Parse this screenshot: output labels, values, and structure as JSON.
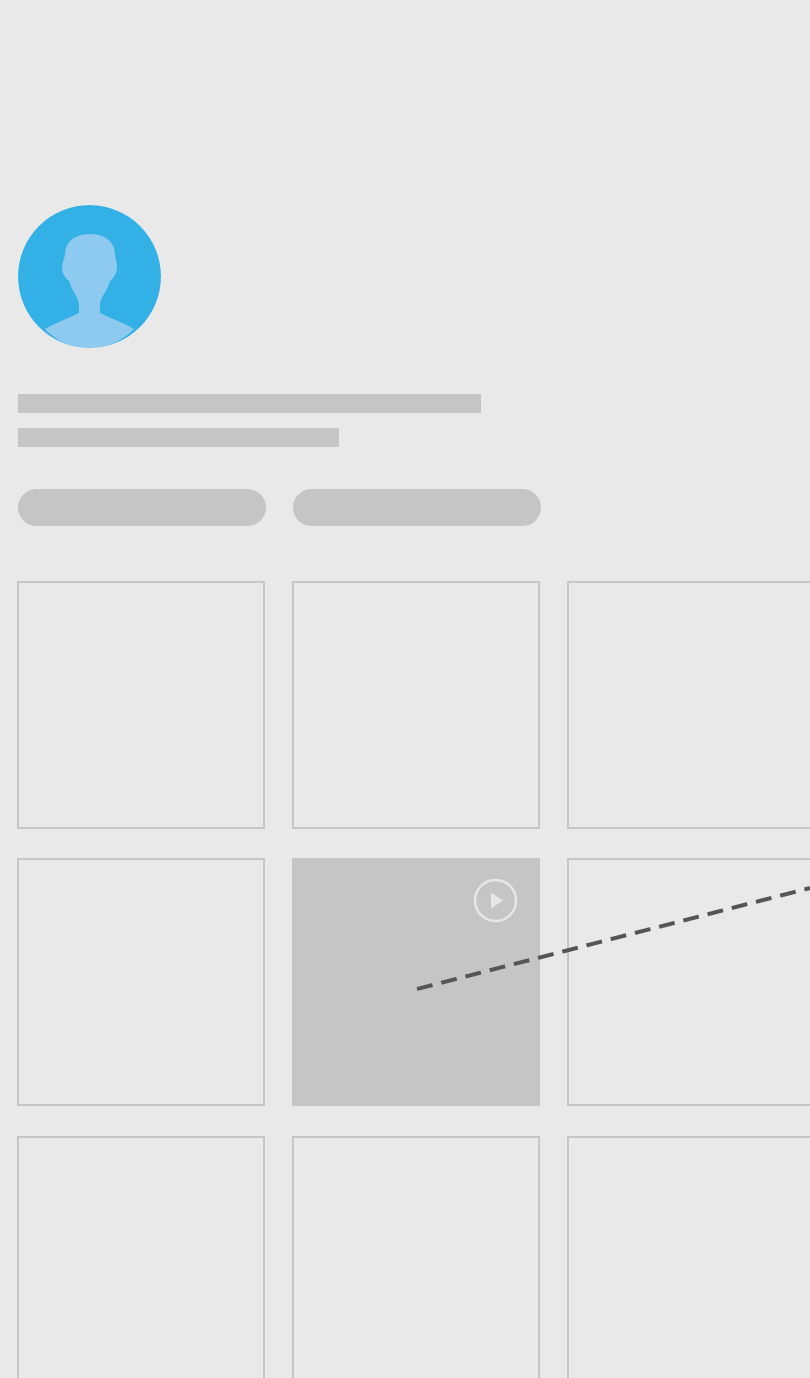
{
  "profile": {
    "avatar_icon": "person-silhouette-icon",
    "avatar_color": "#33b1e6",
    "silhouette_color": "#8ec9f0"
  },
  "placeholders": {
    "color": "#c5c5c5",
    "text_lines": [
      "",
      ""
    ],
    "buttons": [
      "",
      ""
    ]
  },
  "grid": {
    "rows": 3,
    "columns": 3,
    "border_color": "#c6c6c6",
    "highlighted_tile": {
      "row": 2,
      "column": 2,
      "icon": "play-icon"
    }
  },
  "gesture": {
    "style": "dashed",
    "color": "#555555"
  }
}
